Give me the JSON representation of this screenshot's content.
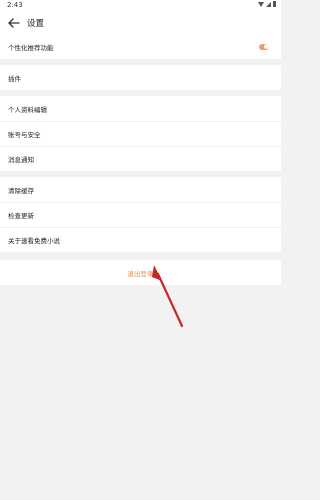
{
  "status_bar": {
    "time": "2:43"
  },
  "header": {
    "title": "设置"
  },
  "groups": [
    {
      "items": [
        {
          "label": "个性化推荐功能",
          "toggle_on": true
        }
      ]
    },
    {
      "items": [
        {
          "label": "插件"
        }
      ]
    },
    {
      "items": [
        {
          "label": "个人资料编辑"
        },
        {
          "label": "账号与安全"
        },
        {
          "label": "消息通知"
        }
      ]
    },
    {
      "items": [
        {
          "label": "清除缓存"
        },
        {
          "label": "检查更新"
        },
        {
          "label": "关于速看免费小说"
        }
      ]
    }
  ],
  "logout_label": "退出登录",
  "colors": {
    "accent": "#f28a4a",
    "annotation_arrow": "#c62828"
  }
}
